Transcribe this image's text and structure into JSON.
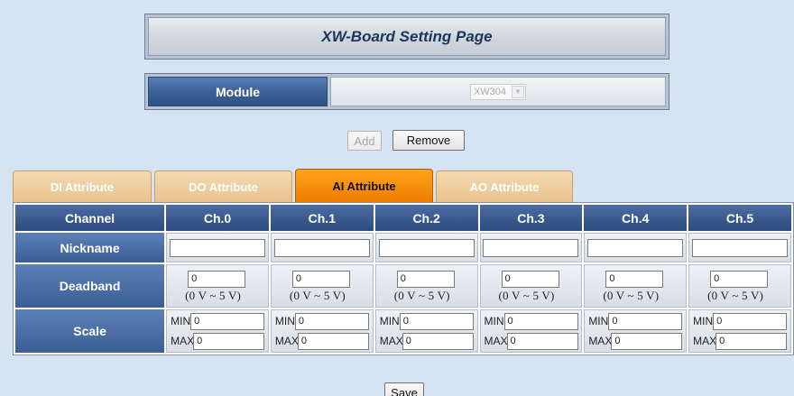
{
  "page_title": "XW-Board Setting Page",
  "module": {
    "label": "Module",
    "selected": "XW304"
  },
  "buttons": {
    "add": "Add",
    "remove": "Remove",
    "save": "Save"
  },
  "tabs": [
    {
      "label": "DI Attribute",
      "active": false
    },
    {
      "label": "DO Attribute",
      "active": false
    },
    {
      "label": "AI Attribute",
      "active": true
    },
    {
      "label": "AO Attribute",
      "active": false
    }
  ],
  "table": {
    "header_label": "Channel",
    "channels": [
      "Ch.0",
      "Ch.1",
      "Ch.2",
      "Ch.3",
      "Ch.4",
      "Ch.5"
    ],
    "row_labels": {
      "nickname": "Nickname",
      "deadband": "Deadband",
      "scale": "Scale"
    },
    "nickname_values": [
      "",
      "",
      "",
      "",
      "",
      ""
    ],
    "deadband_values": [
      "0",
      "0",
      "0",
      "0",
      "0",
      "0"
    ],
    "deadband_unit": "(0 V ~ 5 V)",
    "scale_min_label": "MIN",
    "scale_max_label": "MAX",
    "scale_min_values": [
      "0",
      "0",
      "0",
      "0",
      "0",
      "0"
    ],
    "scale_max_values": [
      "0",
      "0",
      "0",
      "0",
      "0",
      "0"
    ]
  },
  "colors": {
    "background": "#d6e3f3",
    "header_blue": "#2c4a7c",
    "active_tab": "#f07c00",
    "inactive_tab": "#e8c38f"
  }
}
